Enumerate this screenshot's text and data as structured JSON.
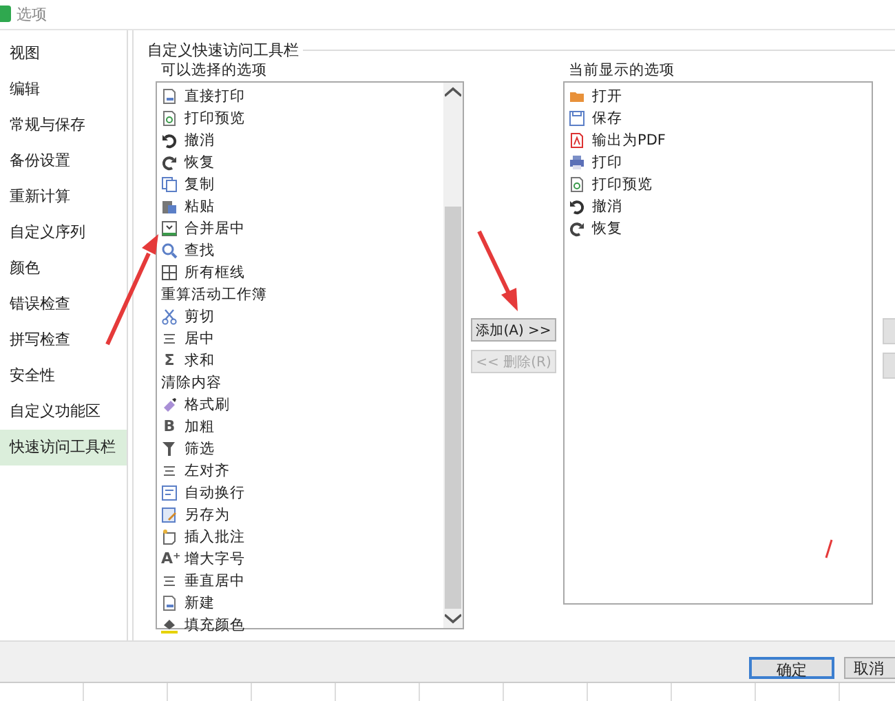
{
  "window": {
    "title": "选项"
  },
  "sidebar": {
    "items": [
      {
        "label": "视图",
        "selected": false
      },
      {
        "label": "编辑",
        "selected": false
      },
      {
        "label": "常规与保存",
        "selected": false
      },
      {
        "label": "备份设置",
        "selected": false
      },
      {
        "label": "重新计算",
        "selected": false
      },
      {
        "label": "自定义序列",
        "selected": false
      },
      {
        "label": "颜色",
        "selected": false
      },
      {
        "label": "错误检查",
        "selected": false
      },
      {
        "label": "拼写检查",
        "selected": false
      },
      {
        "label": "安全性",
        "selected": false
      },
      {
        "label": "自定义功能区",
        "selected": false
      },
      {
        "label": "快速访问工具栏",
        "selected": true
      }
    ]
  },
  "group": {
    "title": "自定义快速访问工具栏",
    "available": {
      "label": "可以选择的选项",
      "items": [
        {
          "label": "直接打印",
          "kind": "page"
        },
        {
          "label": "打印预览",
          "kind": "preview"
        },
        {
          "label": "撤消",
          "kind": "undo"
        },
        {
          "label": "恢复",
          "kind": "redo"
        },
        {
          "label": "复制",
          "kind": "copy"
        },
        {
          "label": "粘贴",
          "kind": "paste"
        },
        {
          "label": "合并居中",
          "kind": "merge"
        },
        {
          "label": "查找",
          "kind": "search"
        },
        {
          "label": "所有框线",
          "kind": "grid"
        },
        {
          "label": "重算活动工作簿",
          "kind": "none"
        },
        {
          "label": "剪切",
          "kind": "cut"
        },
        {
          "label": "居中",
          "kind": "lines"
        },
        {
          "label": "求和",
          "kind": "glyph",
          "glyph": "Σ"
        },
        {
          "label": "清除内容",
          "kind": "none"
        },
        {
          "label": "格式刷",
          "kind": "brush"
        },
        {
          "label": "加粗",
          "kind": "glyph",
          "glyph": "B"
        },
        {
          "label": "筛选",
          "kind": "filter"
        },
        {
          "label": "左对齐",
          "kind": "lines"
        },
        {
          "label": "自动换行",
          "kind": "wrap"
        },
        {
          "label": "另存为",
          "kind": "saveas"
        },
        {
          "label": "插入批注",
          "kind": "note"
        },
        {
          "label": "增大字号",
          "kind": "glyph",
          "glyph": "A⁺"
        },
        {
          "label": "垂直居中",
          "kind": "lines"
        },
        {
          "label": "新建",
          "kind": "page"
        },
        {
          "label": "填充颜色",
          "kind": "fill"
        }
      ]
    },
    "buttons": [
      {
        "label": "添加(A) >>",
        "disabled": false
      },
      {
        "label": "<< 删除(R)",
        "disabled": true
      }
    ],
    "current": {
      "label": "当前显示的选项",
      "items": [
        {
          "label": "打开",
          "kind": "folder"
        },
        {
          "label": "保存",
          "kind": "save"
        },
        {
          "label": "输出为PDF",
          "kind": "pdf"
        },
        {
          "label": "打印",
          "kind": "printer"
        },
        {
          "label": "打印预览",
          "kind": "preview"
        },
        {
          "label": "撤消",
          "kind": "undo"
        },
        {
          "label": "恢复",
          "kind": "redo"
        }
      ]
    }
  },
  "footer": {
    "buttons": [
      {
        "label": "确定",
        "default": true
      },
      {
        "label": "取消",
        "default": false
      }
    ]
  }
}
